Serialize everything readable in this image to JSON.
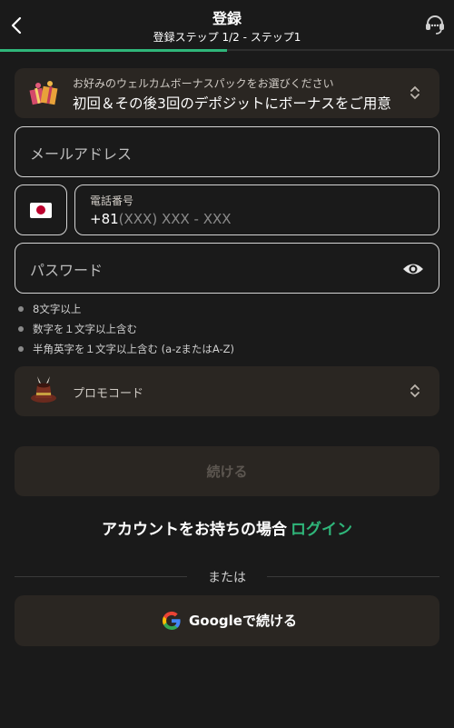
{
  "header": {
    "title": "登録",
    "subtitle": "登録ステップ 1/2 - ステップ1",
    "step_progress": 0.5,
    "accent_color": "#2fb67a"
  },
  "bonus": {
    "hint": "お好みのウェルカムボーナスパックをお選びください",
    "value": "初回＆その後3回のデポジットにボーナスをご用意",
    "icon": "gift-icon"
  },
  "email": {
    "placeholder": "メールアドレス"
  },
  "phone": {
    "country_flag": "japan-flag-icon",
    "label": "電話番号",
    "code": "+81",
    "mask": "(XXX) XXX - XXX"
  },
  "password": {
    "placeholder": "パスワード",
    "rules": [
      "8文字以上",
      "数字を１文字以上含む",
      "半角英字を１文字以上含む (a-zまたはA-Z)"
    ]
  },
  "promo": {
    "label": "プロモコード",
    "icon": "magic-hat-icon"
  },
  "continue_button": {
    "label": "続ける"
  },
  "login": {
    "prompt": "アカウントをお持ちの場合",
    "link": "ログイン"
  },
  "divider": {
    "text": "または"
  },
  "google_button": {
    "label": "Googleで続ける"
  }
}
